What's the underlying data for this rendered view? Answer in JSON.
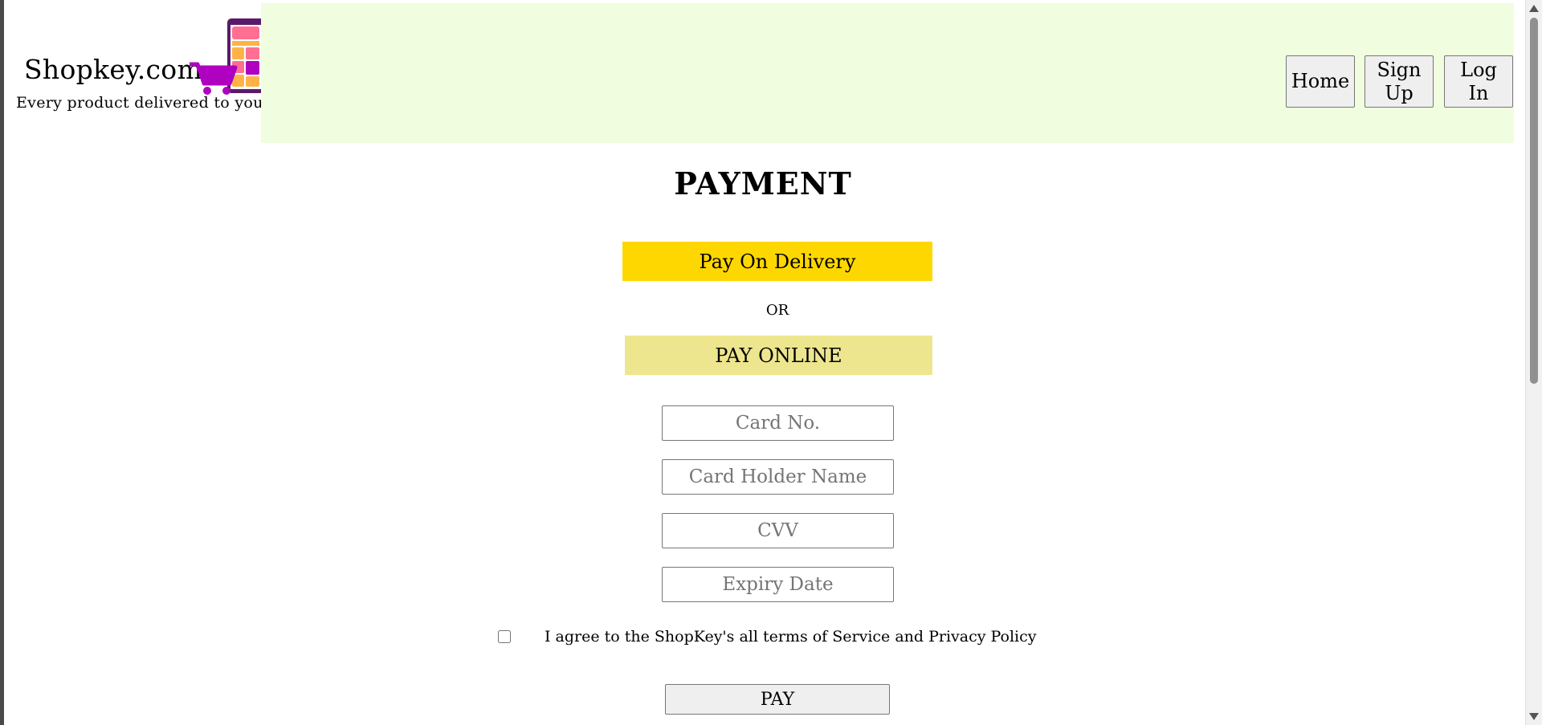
{
  "brand": {
    "name": "Shopkey.com",
    "tagline": "Every product delivered to you."
  },
  "nav": {
    "home": "Home",
    "sign_up": "Sign Up",
    "log_in": "Log In"
  },
  "page_title": "PAYMENT",
  "options": {
    "pay_on_delivery": "Pay On Delivery",
    "or": "OR",
    "pay_online": "PAY ONLINE"
  },
  "form": {
    "card_no_placeholder": "Card No.",
    "card_holder_placeholder": "Card Holder Name",
    "cvv_placeholder": "CVV",
    "expiry_placeholder": "Expiry Date",
    "agree_text": "I agree to the ShopKey's all terms of Service and Privacy Policy",
    "agree_checked": false,
    "pay_label": "PAY"
  },
  "colors": {
    "header_bg": "#f0fddf",
    "pay_on_delivery_bg": "#ffd700",
    "pay_online_bg": "#eee68e",
    "logo_cart": "#b000c0",
    "logo_phone": "#5a1a6a",
    "logo_pink": "#ff6f91",
    "logo_orange": "#ffb347"
  },
  "icons": {
    "logo": "shopping-cart-phone-icon"
  }
}
